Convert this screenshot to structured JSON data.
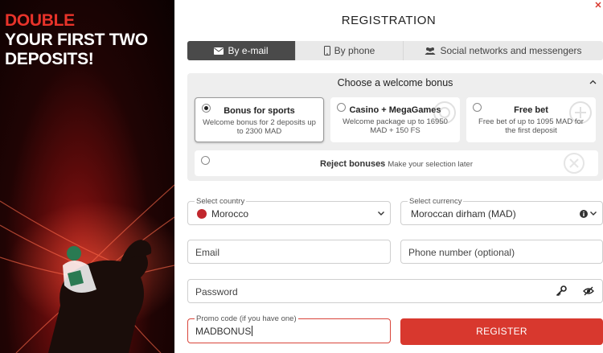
{
  "promo": {
    "line1": "DOUBLE",
    "line2": "YOUR FIRST TWO",
    "line3": "DEPOSITS!"
  },
  "form": {
    "title": "REGISTRATION",
    "tabs": [
      {
        "label": "By e-mail",
        "icon": "envelope-icon",
        "active": true
      },
      {
        "label": "By phone",
        "icon": "phone-icon",
        "active": false
      },
      {
        "label": "Social networks and messengers",
        "icon": "users-icon",
        "active": false
      }
    ],
    "bonus": {
      "heading": "Choose a welcome bonus",
      "options": [
        {
          "title": "Bonus for sports",
          "desc": "Welcome bonus for 2 deposits up to 2300 MAD",
          "selected": true
        },
        {
          "title": "Casino + MegaGames",
          "desc": "Welcome package up to 16950 MAD + 150 FS",
          "selected": false
        },
        {
          "title": "Free bet",
          "desc": "Free bet of up to 1095 MAD for the first deposit",
          "selected": false
        }
      ],
      "reject_label": "Reject bonuses",
      "reject_sub": "Make your selection later"
    },
    "country": {
      "label": "Select country",
      "value": "Morocco"
    },
    "currency": {
      "label": "Select currency",
      "value": "Moroccan dirham (MAD)"
    },
    "email": {
      "placeholder": "Email"
    },
    "phone": {
      "placeholder": "Phone number (optional)"
    },
    "password": {
      "placeholder": "Password"
    },
    "promo_code": {
      "label": "Promo code (if you have one)",
      "value": "MADBONUS"
    },
    "register_label": "REGISTER"
  },
  "colors": {
    "accent": "#d8382e",
    "tab_active": "#4a4a4a",
    "panel_bg": "#eeeeee"
  }
}
